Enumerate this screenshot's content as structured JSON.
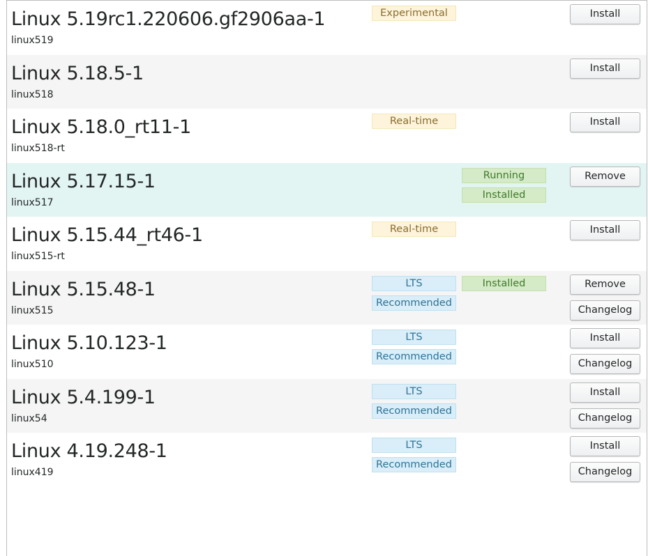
{
  "kernels": [
    {
      "name": "Linux 5.19rc1.220606.gf2906aa-1",
      "package": "linux519",
      "badges_col1": [
        "Experimental"
      ],
      "badges_col2": [],
      "actions": [
        "Install"
      ]
    },
    {
      "name": "Linux 5.18.5-1",
      "package": "linux518",
      "badges_col1": [],
      "badges_col2": [],
      "actions": [
        "Install"
      ]
    },
    {
      "name": "Linux 5.18.0_rt11-1",
      "package": "linux518-rt",
      "badges_col1": [
        "Real-time"
      ],
      "badges_col2": [],
      "actions": [
        "Install"
      ]
    },
    {
      "name": "Linux 5.17.15-1",
      "package": "linux517",
      "badges_col1": [],
      "badges_col2": [
        "Running",
        "Installed"
      ],
      "actions": [
        "Remove"
      ],
      "highlighted": true
    },
    {
      "name": "Linux 5.15.44_rt46-1",
      "package": "linux515-rt",
      "badges_col1": [
        "Real-time"
      ],
      "badges_col2": [],
      "actions": [
        "Install"
      ]
    },
    {
      "name": "Linux 5.15.48-1",
      "package": "linux515",
      "badges_col1": [
        "LTS",
        "Recommended"
      ],
      "badges_col2": [
        "Installed"
      ],
      "actions": [
        "Remove",
        "Changelog"
      ]
    },
    {
      "name": "Linux 5.10.123-1",
      "package": "linux510",
      "badges_col1": [
        "LTS",
        "Recommended"
      ],
      "badges_col2": [],
      "actions": [
        "Install",
        "Changelog"
      ]
    },
    {
      "name": "Linux 5.4.199-1",
      "package": "linux54",
      "badges_col1": [
        "LTS",
        "Recommended"
      ],
      "badges_col2": [],
      "actions": [
        "Install",
        "Changelog"
      ]
    },
    {
      "name": "Linux 4.19.248-1",
      "package": "linux419",
      "badges_col1": [
        "LTS",
        "Recommended"
      ],
      "badges_col2": [],
      "actions": [
        "Install",
        "Changelog"
      ]
    }
  ],
  "colors": {
    "row_alt": "#f5f5f5",
    "row_highlight": "#e2f5f2",
    "badge_yellow": "#fdf4db",
    "badge_blue": "#d9eef8",
    "badge_green": "#d5eac6"
  }
}
